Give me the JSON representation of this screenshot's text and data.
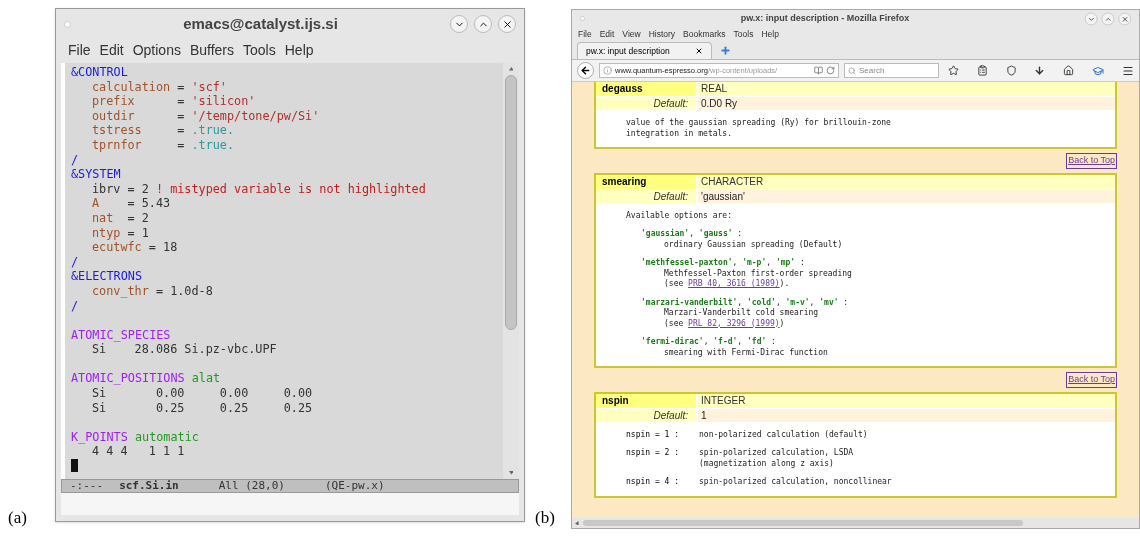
{
  "panels": [
    {
      "label": "(a)",
      "kind": "editor",
      "window": {
        "title": "emacs@catalyst.ijs.si"
      },
      "menu": [
        "File",
        "Edit",
        "Options",
        "Buffers",
        "Tools",
        "Help"
      ],
      "groups": [
        {
          "items": [
            {
              "segments": [
                {
                  "t": "&CONTROL",
                  "kind": "section"
                }
              ],
              "children": [
                {
                  "segments": [
                    {
                      "t": "calculation",
                      "kind": "var"
                    },
                    {
                      "t": " = ",
                      "kind": "plain"
                    },
                    {
                      "t": "'scf'",
                      "kind": "str"
                    }
                  ]
                },
                {
                  "segments": [
                    {
                      "t": "prefix",
                      "kind": "var"
                    },
                    {
                      "t": "      = ",
                      "kind": "plain"
                    },
                    {
                      "t": "'silicon'",
                      "kind": "str"
                    }
                  ]
                },
                {
                  "segments": [
                    {
                      "t": "outdir",
                      "kind": "var"
                    },
                    {
                      "t": "      = ",
                      "kind": "plain"
                    },
                    {
                      "t": "'/temp/tone/pw/Si'",
                      "kind": "str"
                    }
                  ]
                },
                {
                  "segments": [
                    {
                      "t": "tstress",
                      "kind": "var"
                    },
                    {
                      "t": "     = ",
                      "kind": "plain"
                    },
                    {
                      "t": ".true.",
                      "kind": "bool"
                    }
                  ]
                },
                {
                  "segments": [
                    {
                      "t": "tprnfor",
                      "kind": "var"
                    },
                    {
                      "t": "     = ",
                      "kind": "plain"
                    },
                    {
                      "t": ".true.",
                      "kind": "bool"
                    }
                  ]
                }
              ]
            },
            {
              "segments": [
                {
                  "t": "/",
                  "kind": "section"
                }
              ]
            },
            {
              "segments": [
                {
                  "t": "&SYSTEM",
                  "kind": "section"
                }
              ],
              "children": [
                {
                  "segments": [
                    {
                      "t": "ibrv = 2 ",
                      "kind": "plain"
                    },
                    {
                      "t": "! mistyped variable is not highlighted",
                      "kind": "comment"
                    }
                  ]
                },
                {
                  "segments": [
                    {
                      "t": "A",
                      "kind": "var"
                    },
                    {
                      "t": "    = 5.43",
                      "kind": "plain"
                    }
                  ]
                },
                {
                  "segments": [
                    {
                      "t": "nat",
                      "kind": "var"
                    },
                    {
                      "t": "  = 2",
                      "kind": "plain"
                    }
                  ]
                },
                {
                  "segments": [
                    {
                      "t": "ntyp",
                      "kind": "var"
                    },
                    {
                      "t": " = 1",
                      "kind": "plain"
                    }
                  ]
                },
                {
                  "segments": [
                    {
                      "t": "ecutwfc",
                      "kind": "var"
                    },
                    {
                      "t": " = 18",
                      "kind": "plain"
                    }
                  ]
                }
              ]
            },
            {
              "segments": [
                {
                  "t": "/",
                  "kind": "section"
                }
              ]
            },
            {
              "segments": [
                {
                  "t": "&ELECTRONS",
                  "kind": "section"
                }
              ],
              "children": [
                {
                  "segments": [
                    {
                      "t": "conv_thr",
                      "kind": "var"
                    },
                    {
                      "t": " = 1.0d-8",
                      "kind": "plain"
                    }
                  ]
                }
              ]
            },
            {
              "segments": [
                {
                  "t": "/",
                  "kind": "section"
                }
              ]
            }
          ]
        },
        {
          "items": [
            {
              "segments": [
                {
                  "t": "ATOMIC_SPECIES",
                  "kind": "card"
                }
              ],
              "children": [
                {
                  "segments": [
                    {
                      "t": "Si    28.086 Si.pz-vbc.UPF",
                      "kind": "plain"
                    }
                  ]
                }
              ]
            }
          ]
        },
        {
          "items": [
            {
              "segments": [
                {
                  "t": "ATOMIC_POSITIONS",
                  "kind": "card"
                },
                {
                  "t": " alat",
                  "kind": "opt"
                }
              ],
              "children": [
                {
                  "segments": [
                    {
                      "t": "Si       0.00     0.00     0.00",
                      "kind": "plain"
                    }
                  ]
                },
                {
                  "segments": [
                    {
                      "t": "Si       0.25     0.25     0.25",
                      "kind": "plain"
                    }
                  ]
                }
              ]
            }
          ]
        },
        {
          "items": [
            {
              "segments": [
                {
                  "t": "K_POINTS",
                  "kind": "card"
                },
                {
                  "t": " automatic",
                  "kind": "opt"
                }
              ],
              "children": [
                {
                  "segments": [
                    {
                      "t": "4 4 4   1 1 1",
                      "kind": "plain"
                    }
                  ]
                }
              ]
            }
          ]
        }
      ],
      "cursor": true,
      "mode_line": {
        "status": "-:---",
        "buffer": "scf.Si.in",
        "position": "All (28,0)",
        "mode": "(QE-pw.x)"
      }
    },
    {
      "label": "(b)",
      "kind": "browser",
      "window": {
        "title": "pw.x: input description - Mozilla Firefox"
      },
      "menu": [
        "File",
        "Edit",
        "View",
        "History",
        "Bookmarks",
        "Tools",
        "Help"
      ],
      "tab": {
        "title": "pw.x: input description",
        "selected": true
      },
      "url": {
        "host": "www.quantum-espresso.org",
        "path": "/wp-content/uploads/"
      },
      "search": {
        "placeholder": "Search"
      },
      "entries": [
        {
          "name": "degauss",
          "type": "REAL",
          "default_label": "Default:",
          "default": "0.D0 Ry",
          "top_cut": true,
          "groups": [
            {
              "items": [
                {
                  "segments": [
                    {
                      "t": "value of the gaussian spreading (Ry) for brillouin-zone",
                      "kind": "plain"
                    }
                  ]
                },
                {
                  "segments": [
                    {
                      "t": "integration in metals.",
                      "kind": "plain"
                    }
                  ]
                }
              ]
            }
          ],
          "back_link": "Back to Top"
        },
        {
          "name": "smearing",
          "type": "CHARACTER",
          "default_label": "Default:",
          "default": "'gaussian'",
          "top_cut": false,
          "groups": [
            {
              "items": [
                {
                  "segments": [
                    {
                      "t": "Available options are:",
                      "kind": "plain"
                    }
                  ],
                  "groups": [
                    {
                      "items": [
                        {
                          "segments": [
                            {
                              "t": "'gaussian'",
                              "kind": "key"
                            },
                            {
                              "t": ", ",
                              "kind": "plain"
                            },
                            {
                              "t": "'gauss'",
                              "kind": "key"
                            },
                            {
                              "t": " :",
                              "kind": "plain"
                            }
                          ],
                          "children": [
                            {
                              "segments": [
                                {
                                  "t": "ordinary Gaussian spreading (Default)",
                                  "kind": "plain"
                                }
                              ]
                            }
                          ]
                        }
                      ]
                    },
                    {
                      "items": [
                        {
                          "segments": [
                            {
                              "t": "'methfessel-paxton'",
                              "kind": "key"
                            },
                            {
                              "t": ", ",
                              "kind": "plain"
                            },
                            {
                              "t": "'m-p'",
                              "kind": "key"
                            },
                            {
                              "t": ", ",
                              "kind": "plain"
                            },
                            {
                              "t": "'mp'",
                              "kind": "key"
                            },
                            {
                              "t": " :",
                              "kind": "plain"
                            }
                          ],
                          "children": [
                            {
                              "segments": [
                                {
                                  "t": "Methfessel-Paxton first-order spreading",
                                  "kind": "plain"
                                }
                              ]
                            },
                            {
                              "segments": [
                                {
                                  "t": "(see ",
                                  "kind": "plain"
                                },
                                {
                                  "t": "PRB 40, 3616 (1989)",
                                  "kind": "link"
                                },
                                {
                                  "t": ").",
                                  "kind": "plain"
                                }
                              ]
                            }
                          ]
                        }
                      ]
                    },
                    {
                      "items": [
                        {
                          "segments": [
                            {
                              "t": "'marzari-vanderbilt'",
                              "kind": "key"
                            },
                            {
                              "t": ", ",
                              "kind": "plain"
                            },
                            {
                              "t": "'cold'",
                              "kind": "key"
                            },
                            {
                              "t": ", ",
                              "kind": "plain"
                            },
                            {
                              "t": "'m-v'",
                              "kind": "key"
                            },
                            {
                              "t": ", ",
                              "kind": "plain"
                            },
                            {
                              "t": "'mv'",
                              "kind": "key"
                            },
                            {
                              "t": " :",
                              "kind": "plain"
                            }
                          ],
                          "children": [
                            {
                              "segments": [
                                {
                                  "t": "Marzari-Vanderbilt cold smearing",
                                  "kind": "plain"
                                }
                              ]
                            },
                            {
                              "segments": [
                                {
                                  "t": "(see ",
                                  "kind": "plain"
                                },
                                {
                                  "t": "PRL 82, 3296 (1999)",
                                  "kind": "link"
                                },
                                {
                                  "t": ")",
                                  "kind": "plain"
                                }
                              ]
                            }
                          ]
                        }
                      ]
                    },
                    {
                      "items": [
                        {
                          "segments": [
                            {
                              "t": "'fermi-dirac'",
                              "kind": "key"
                            },
                            {
                              "t": ", ",
                              "kind": "plain"
                            },
                            {
                              "t": "'f-d'",
                              "kind": "key"
                            },
                            {
                              "t": ", ",
                              "kind": "plain"
                            },
                            {
                              "t": "'fd'",
                              "kind": "key"
                            },
                            {
                              "t": " :",
                              "kind": "plain"
                            }
                          ],
                          "children": [
                            {
                              "segments": [
                                {
                                  "t": "smearing with Fermi-Dirac function",
                                  "kind": "plain"
                                }
                              ]
                            }
                          ]
                        }
                      ]
                    }
                  ]
                }
              ]
            }
          ],
          "back_link": "Back to Top"
        },
        {
          "name": "nspin",
          "type": "INTEGER",
          "default_label": "Default:",
          "default": "1",
          "top_cut": false,
          "groups": [
            {
              "items": [
                {
                  "term": "nspin = 1 :",
                  "segments": [
                    {
                      "t": "non-polarized calculation (default)",
                      "kind": "plain"
                    }
                  ]
                }
              ]
            },
            {
              "items": [
                {
                  "term": "nspin = 2 :",
                  "segments": [
                    {
                      "t": "spin-polarized calculation, LSDA",
                      "kind": "plain"
                    }
                  ],
                  "children": [
                    {
                      "segments": [
                        {
                          "t": "(magnetization along z axis)",
                          "kind": "plain"
                        }
                      ]
                    }
                  ]
                }
              ]
            },
            {
              "items": [
                {
                  "term": "nspin = 4 :",
                  "segments": [
                    {
                      "t": "spin-polarized calculation, noncollinear",
                      "kind": "plain"
                    }
                  ]
                }
              ]
            }
          ]
        }
      ]
    }
  ]
}
